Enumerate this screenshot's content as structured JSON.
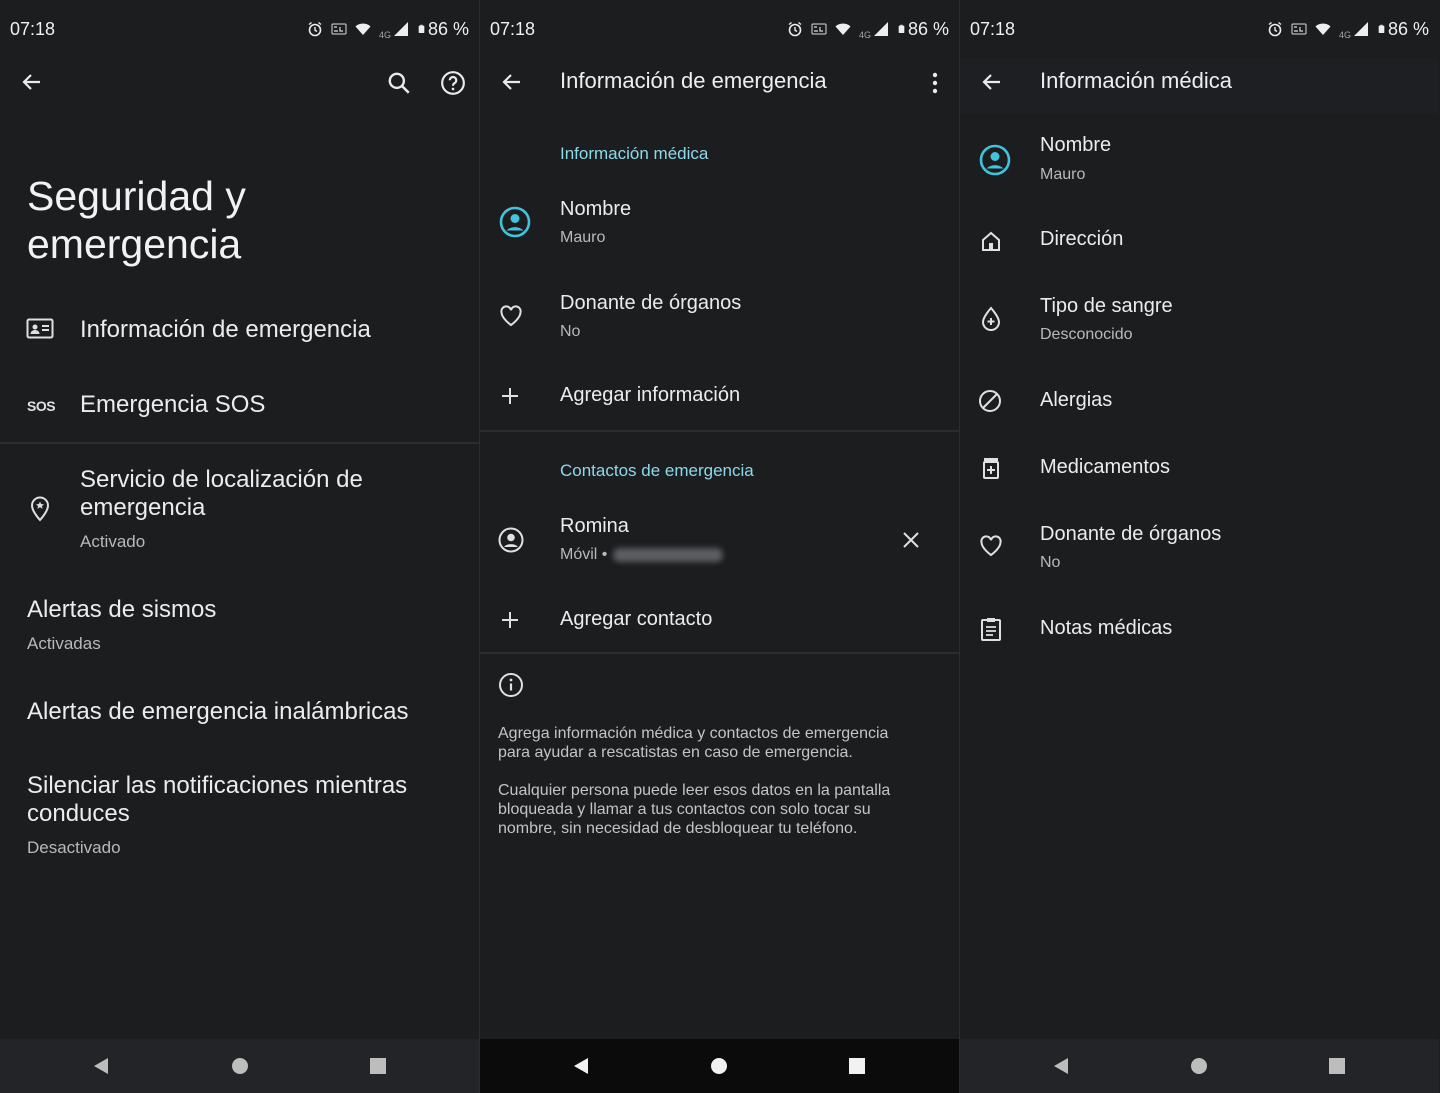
{
  "status": {
    "time": "07:18",
    "network": "4G",
    "battery": "86 %"
  },
  "screen1": {
    "title_line1": "Seguridad y",
    "title_line2": "emergencia",
    "items": [
      {
        "label": "Información de emergencia"
      },
      {
        "icon_text": "SOS",
        "label": "Emergencia SOS"
      },
      {
        "label_line1": "Servicio de localización de",
        "label_line2": "emergencia",
        "sub": "Activado"
      },
      {
        "label": "Alertas de sismos",
        "sub": "Activadas"
      },
      {
        "label": "Alertas de emergencia inalámbricas"
      },
      {
        "label_line1": "Silenciar las notificaciones mientras",
        "label_line2": "conduces",
        "sub": "Desactivado"
      }
    ]
  },
  "screen2": {
    "title": "Información de emergencia",
    "section_medical": "Información médica",
    "name_label": "Nombre",
    "name_value": "Mauro",
    "donor_label": "Donante de órganos",
    "donor_value": "No",
    "add_info": "Agregar información",
    "section_contacts": "Contactos de emergencia",
    "contact_name": "Romina",
    "contact_type": "Móvil •",
    "add_contact": "Agregar contacto",
    "info_p1_l1": "Agrega información médica y contactos de emergencia",
    "info_p1_l2": "para ayudar a rescatistas en caso de emergencia.",
    "info_p2_l1": "Cualquier persona puede leer esos datos en la pantalla",
    "info_p2_l2": "bloqueada y llamar a tus contactos con solo tocar su",
    "info_p2_l3": "nombre, sin necesidad de desbloquear tu teléfono."
  },
  "screen3": {
    "title": "Información médica",
    "items": [
      {
        "label": "Nombre",
        "sub": "Mauro"
      },
      {
        "label": "Dirección"
      },
      {
        "label": "Tipo de sangre",
        "sub": "Desconocido"
      },
      {
        "label": "Alergias"
      },
      {
        "label": "Medicamentos"
      },
      {
        "label": "Donante de órganos",
        "sub": "No"
      },
      {
        "label": "Notas médicas"
      }
    ]
  },
  "colors": {
    "accent": "#8dd9ea",
    "avatar": "#3fc4dc",
    "background": "#1c1d1f",
    "navbar": "#0b0b0c"
  }
}
